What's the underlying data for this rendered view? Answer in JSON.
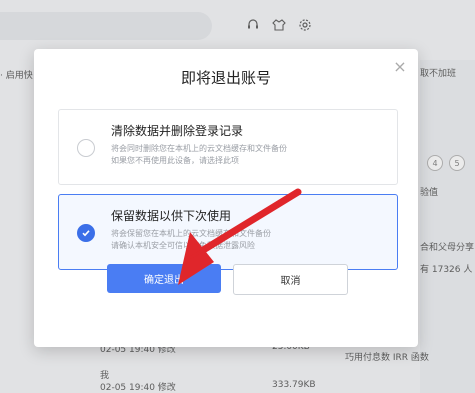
{
  "background": {
    "left_text": "· 启用快",
    "right_text_1": "取不加班",
    "right_text_2": "验值",
    "right_text_3": "合和父母分享!",
    "right_text_4": "有 17326 人",
    "bottom_text": "巧用付息数 IRR 函数",
    "step_numbers": [
      "4",
      "5"
    ],
    "row1_date": "02-05 19:40 修改",
    "row1_size": "25.00KB",
    "row2_owner": "我",
    "row2_date": "02-05 19:40 修改",
    "row2_size": "333.79KB"
  },
  "dialog": {
    "title": "即将退出账号",
    "close_label": "×",
    "option1": {
      "title": "清除数据并删除登录记录",
      "desc_line1": "将会同时删除您在本机上的云文档缓存和文件备份",
      "desc_line2": "如果您不再使用此设备，请选择此项"
    },
    "option2": {
      "title": "保留数据以供下次使用",
      "desc_line1": "将会保留您在本机上的云文档缓存和文件备份",
      "desc_line2": "请确认本机安全可信以避免数据泄露风险"
    },
    "confirm_label": "确定退出",
    "cancel_label": "取消"
  },
  "colors": {
    "accent": "#4a7df3",
    "arrow": "#e0262b"
  },
  "icons": [
    "headset-icon",
    "shirt-icon",
    "gear-icon",
    "close-icon",
    "check-icon"
  ]
}
